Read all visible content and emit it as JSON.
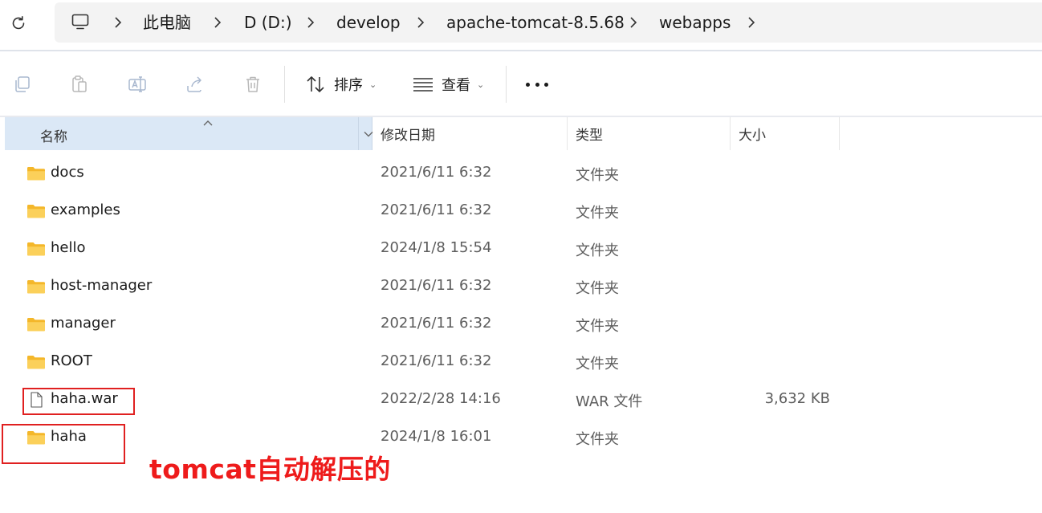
{
  "address": {
    "path": [
      "此电脑",
      "D (D:)",
      "develop",
      "apache-tomcat-8.5.68",
      "webapps"
    ]
  },
  "toolbar": {
    "sort_label": "排序",
    "view_label": "查看"
  },
  "columns": {
    "name": "名称",
    "modified": "修改日期",
    "type": "类型",
    "size": "大小"
  },
  "files": [
    {
      "name": "docs",
      "modified": "2021/6/11 6:32",
      "type": "文件夹",
      "size": "",
      "icon": "folder-icon"
    },
    {
      "name": "examples",
      "modified": "2021/6/11 6:32",
      "type": "文件夹",
      "size": "",
      "icon": "folder-icon"
    },
    {
      "name": "hello",
      "modified": "2024/1/8 15:54",
      "type": "文件夹",
      "size": "",
      "icon": "folder-icon"
    },
    {
      "name": "host-manager",
      "modified": "2021/6/11 6:32",
      "type": "文件夹",
      "size": "",
      "icon": "folder-icon"
    },
    {
      "name": "manager",
      "modified": "2021/6/11 6:32",
      "type": "文件夹",
      "size": "",
      "icon": "folder-icon"
    },
    {
      "name": "ROOT",
      "modified": "2021/6/11 6:32",
      "type": "文件夹",
      "size": "",
      "icon": "folder-icon"
    },
    {
      "name": "haha.war",
      "modified": "2022/2/28 14:16",
      "type": "WAR 文件",
      "size": "3,632 KB",
      "icon": "file-icon"
    },
    {
      "name": "haha",
      "modified": "2024/1/8 16:01",
      "type": "文件夹",
      "size": "",
      "icon": "folder-icon"
    }
  ],
  "annotation": {
    "text": "tomcat自动解压的",
    "color": "#ee1b1b"
  },
  "colors": {
    "header_selected": "#dbe8f6",
    "folder": "#f8c93f",
    "annotation_box": "#e02020"
  }
}
